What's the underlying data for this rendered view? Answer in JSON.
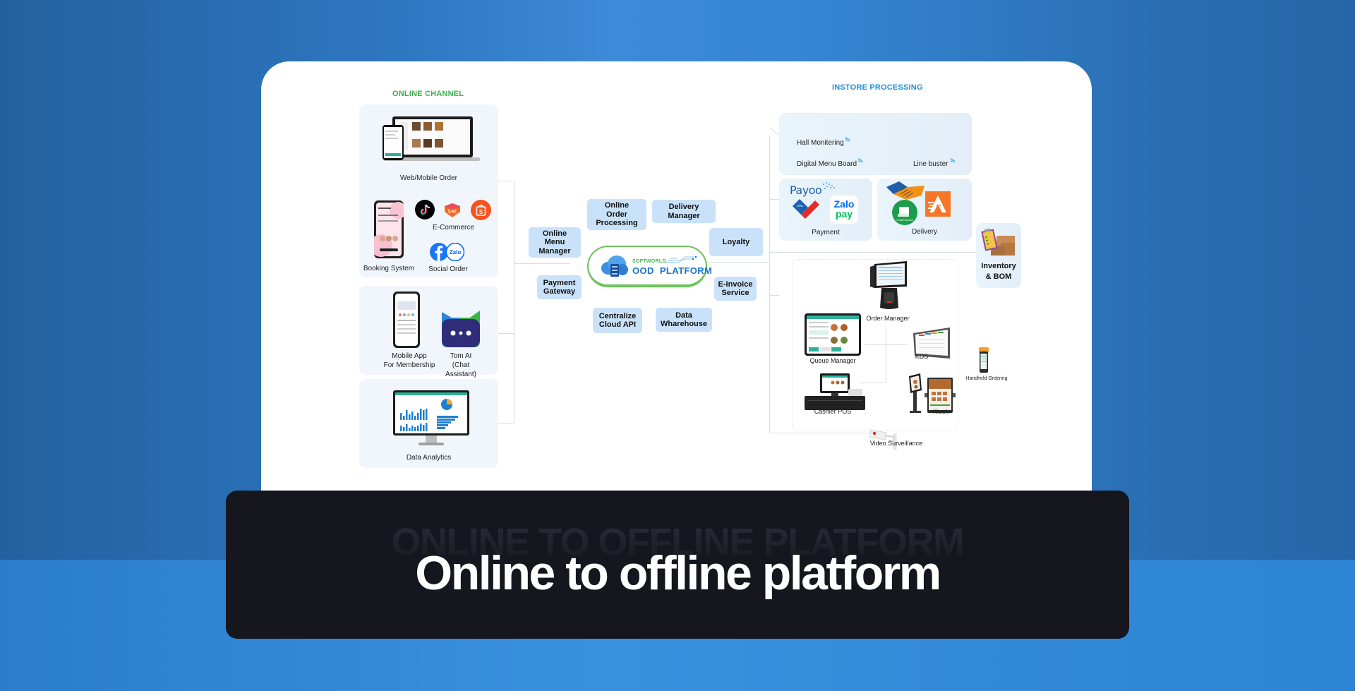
{
  "colors": {
    "online_title": "#38b24a",
    "instore_title": "#1f8fd6",
    "module_bg": "#c9e2fa",
    "banner_bg": "#16161f"
  },
  "diagram": {
    "online_channel": {
      "title": "ONLINE CHANNEL",
      "items": [
        {
          "label": "Web/Mobile Order",
          "icon": "laptop-phone-icon"
        },
        {
          "label": "Booking System",
          "icon": "booking-phone-icon"
        },
        {
          "label": "E-Commerce",
          "icons": [
            "tiktok-icon",
            "lazada-icon",
            "shopee-icon"
          ]
        },
        {
          "label": "Social Order",
          "icons": [
            "facebook-icon",
            "zalo-icon"
          ]
        },
        {
          "label": "Mobile App\nFor Membership",
          "line1": "Mobile App",
          "line2": "For Membership",
          "icon": "membership-phone-icon"
        },
        {
          "label": "Tom AI (Chat Assistant)",
          "line1": "Tom AI",
          "line2": "(Chat",
          "line3": "Assistant)",
          "icon": "tom-ai-bot-icon"
        },
        {
          "label": "Data Analytics",
          "icon": "analytics-monitor-icon"
        }
      ]
    },
    "platform": {
      "brand": "SOFTWORLD",
      "name": "OOD  PLATFORM",
      "modules": [
        {
          "label": "Online\nOrder\nProcessing"
        },
        {
          "label": "Delivery\nManager"
        },
        {
          "label": "Online\nMenu\nManager"
        },
        {
          "label": "Loyalty"
        },
        {
          "label": "Payment\nGateway"
        },
        {
          "label": "E-Invoice\nService"
        },
        {
          "label": "Centralize\nCloud API"
        },
        {
          "label": "Data\nWharehouse"
        }
      ]
    },
    "instore": {
      "title": "INSTORE PROCESSING",
      "signage": [
        {
          "label": "Hall Monitering"
        },
        {
          "label": "Digital Menu Board"
        },
        {
          "label": "Line buster"
        }
      ],
      "payment": {
        "label": "Payment",
        "brands": [
          "Payoo",
          "Zalo",
          "pay"
        ]
      },
      "delivery": {
        "label": "Delivery",
        "brands": [
          "GrabExpress",
          "Ahamove"
        ]
      },
      "inventory": {
        "label": "Inventory\n& BOM"
      },
      "devices": [
        {
          "label": "Order Manager"
        },
        {
          "label": "Queue Manager"
        },
        {
          "label": "KDS"
        },
        {
          "label": "Cashier POS"
        },
        {
          "label": "Kiosk"
        },
        {
          "label": "Handheld Ordering"
        },
        {
          "label": "Video Surveillance"
        }
      ]
    }
  },
  "banner": {
    "ghost_title": "ONLINE TO OFFLINE PLATFORM",
    "title": "Online to offline platform"
  }
}
